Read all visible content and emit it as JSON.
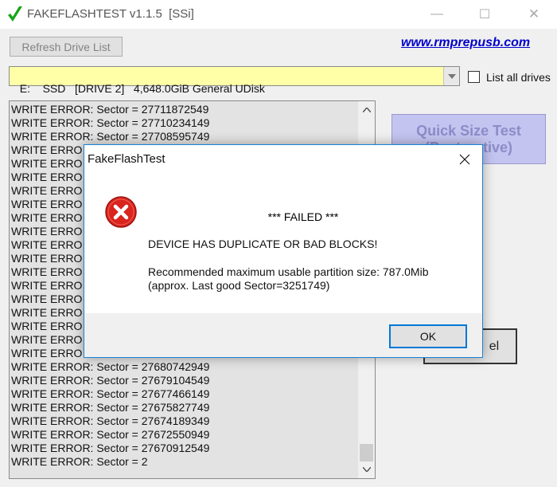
{
  "window": {
    "title": "FAKEFLASHTEST v1.1.5  [SSi]",
    "minimize_glyph": "—",
    "maximize_glyph": "☐",
    "close_glyph": "✕"
  },
  "toolbar": {
    "refresh_label": "Refresh Drive List",
    "site_link": "www.rmprepusb.com"
  },
  "drive": {
    "selected": "E:    SSD   [DRIVE 2]   4,648.0GiB General UDisk",
    "list_all_label": "List all drives",
    "list_all_checked": false
  },
  "log": {
    "lines": [
      "WRITE ERROR: Sector = 27711872549",
      "WRITE ERROR: Sector = 27710234149",
      "WRITE ERROR: Sector = 27708595749",
      "WRITE ERRO",
      "WRITE ERRO",
      "WRITE ERRO",
      "WRITE ERRO",
      "WRITE ERRO",
      "WRITE ERRO",
      "WRITE ERRO",
      "WRITE ERRO",
      "WRITE ERRO",
      "WRITE ERRO",
      "WRITE ERRO",
      "WRITE ERRO",
      "WRITE ERRO",
      "WRITE ERRO",
      "WRITE ERRO",
      "WRITE ERRO",
      "WRITE ERROR: Sector = 27680742949",
      "WRITE ERROR: Sector = 27679104549",
      "WRITE ERROR: Sector = 27677466149",
      "WRITE ERROR: Sector = 27675827749",
      "WRITE ERROR: Sector = 27674189349",
      "WRITE ERROR: Sector = 27672550949",
      "WRITE ERROR: Sector = 27670912549",
      "WRITE ERROR: Sector = 2"
    ]
  },
  "buttons": {
    "quick_line1": "Quick Size Test",
    "quick_line2": "(Destructive)",
    "cancel_label": "el"
  },
  "dialog": {
    "title": "FakeFlashTest",
    "failed": "*** FAILED ***",
    "message": "DEVICE HAS DUPLICATE OR BAD BLOCKS!",
    "recommendation": "Recommended maximum usable partition size: 787.0Mib",
    "detail": "(approx. Last good Sector=3251749)",
    "ok_label": "OK",
    "icon": "error-icon"
  },
  "colors": {
    "drive_bg": "#ffffa8",
    "link": "#0000cc",
    "error_red": "#d9251d",
    "accent_blue": "#0078d7"
  }
}
